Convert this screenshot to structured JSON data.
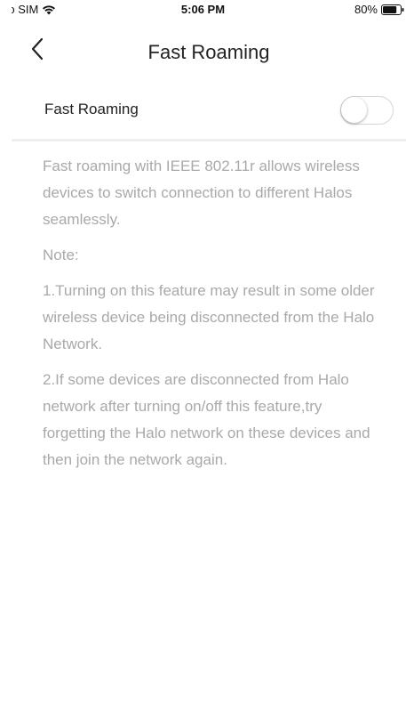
{
  "status_bar": {
    "carrier": "No SIM",
    "time": "5:06 PM",
    "battery_percent": "80%",
    "battery_level": 0.8
  },
  "nav": {
    "title": "Fast Roaming",
    "back_icon": "chevron-left-icon"
  },
  "setting": {
    "label": "Fast Roaming",
    "enabled": false
  },
  "description": {
    "intro": "Fast roaming with IEEE 802.11r allows wireless devices to switch connection to different Halos seamlessly.",
    "note_heading": "Note:",
    "note_1": "1.Turning on this feature may result in some older wireless device being disconnected from the Halo Network.",
    "note_2": "2.If some devices are disconnected from Halo network after turning on/off this feature,try forgetting the Halo network on these devices and then join the network again."
  }
}
